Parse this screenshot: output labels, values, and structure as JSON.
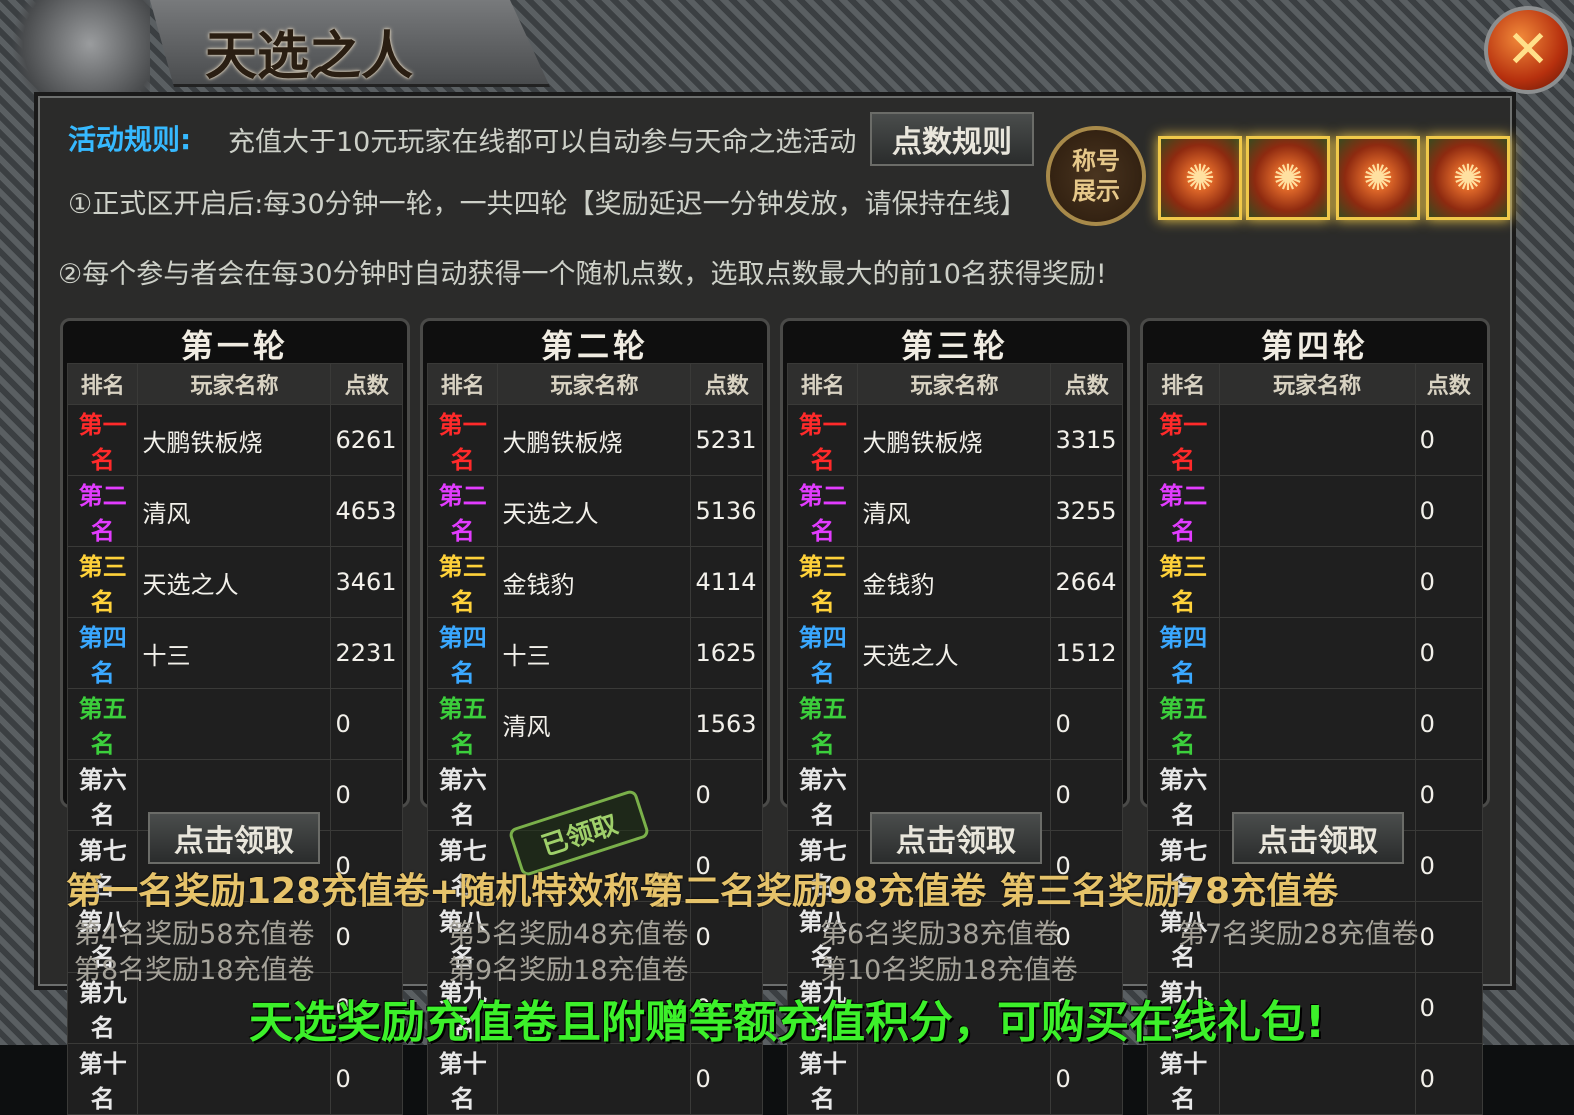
{
  "title": "天选之人",
  "close_icon": "✕",
  "rules": {
    "label": "活动规则:",
    "text": "充值大于10元玩家在线都可以自动参与天命之选活动",
    "points_rule_button": "点数规则",
    "line1": "①正式区开启后:每30分钟一轮，一共四轮【奖励延迟一分钟发放，请保持在线】",
    "line2": "②每个参与者会在每30分钟时自动获得一个随机点数，选取点数最大的前10名获得奖励!"
  },
  "title_display_badge": "称号展示",
  "rounds": [
    {
      "title": "第一轮",
      "headers": [
        "排名",
        "玩家名称",
        "点数"
      ],
      "rows": [
        {
          "rank": "第一名",
          "name": "大鹏铁板烧",
          "points": "6261"
        },
        {
          "rank": "第二名",
          "name": "清风",
          "points": "4653"
        },
        {
          "rank": "第三名",
          "name": "天选之人",
          "points": "3461"
        },
        {
          "rank": "第四名",
          "name": "十三",
          "points": "2231"
        },
        {
          "rank": "第五名",
          "name": "",
          "points": "0"
        },
        {
          "rank": "第六名",
          "name": "",
          "points": "0"
        },
        {
          "rank": "第七名",
          "name": "",
          "points": "0"
        },
        {
          "rank": "第八名",
          "name": "",
          "points": "0"
        },
        {
          "rank": "第九名",
          "name": "",
          "points": "0"
        },
        {
          "rank": "第十名",
          "name": "",
          "points": "0"
        }
      ],
      "claim": "点击领取"
    },
    {
      "title": "第二轮",
      "headers": [
        "排名",
        "玩家名称",
        "点数"
      ],
      "rows": [
        {
          "rank": "第一名",
          "name": "大鹏铁板烧",
          "points": "5231"
        },
        {
          "rank": "第二名",
          "name": "天选之人",
          "points": "5136"
        },
        {
          "rank": "第三名",
          "name": "金钱豹",
          "points": "4114"
        },
        {
          "rank": "第四名",
          "name": "十三",
          "points": "1625"
        },
        {
          "rank": "第五名",
          "name": "清风",
          "points": "1563"
        },
        {
          "rank": "第六名",
          "name": "",
          "points": "0"
        },
        {
          "rank": "第七名",
          "name": "",
          "points": "0"
        },
        {
          "rank": "第八名",
          "name": "",
          "points": "0"
        },
        {
          "rank": "第九名",
          "name": "",
          "points": "0"
        },
        {
          "rank": "第十名",
          "name": "",
          "points": "0"
        }
      ],
      "claim": "已领取"
    },
    {
      "title": "第三轮",
      "headers": [
        "排名",
        "玩家名称",
        "点数"
      ],
      "rows": [
        {
          "rank": "第一名",
          "name": "大鹏铁板烧",
          "points": "3315"
        },
        {
          "rank": "第二名",
          "name": "清风",
          "points": "3255"
        },
        {
          "rank": "第三名",
          "name": "金钱豹",
          "points": "2664"
        },
        {
          "rank": "第四名",
          "name": "天选之人",
          "points": "1512"
        },
        {
          "rank": "第五名",
          "name": "",
          "points": "0"
        },
        {
          "rank": "第六名",
          "name": "",
          "points": "0"
        },
        {
          "rank": "第七名",
          "name": "",
          "points": "0"
        },
        {
          "rank": "第八名",
          "name": "",
          "points": "0"
        },
        {
          "rank": "第九名",
          "name": "",
          "points": "0"
        },
        {
          "rank": "第十名",
          "name": "",
          "points": "0"
        }
      ],
      "claim": "点击领取"
    },
    {
      "title": "第四轮",
      "headers": [
        "排名",
        "玩家名称",
        "点数"
      ],
      "rows": [
        {
          "rank": "第一名",
          "name": "",
          "points": "0"
        },
        {
          "rank": "第二名",
          "name": "",
          "points": "0"
        },
        {
          "rank": "第三名",
          "name": "",
          "points": "0"
        },
        {
          "rank": "第四名",
          "name": "",
          "points": "0"
        },
        {
          "rank": "第五名",
          "name": "",
          "points": "0"
        },
        {
          "rank": "第六名",
          "name": "",
          "points": "0"
        },
        {
          "rank": "第七名",
          "name": "",
          "points": "0"
        },
        {
          "rank": "第八名",
          "name": "",
          "points": "0"
        },
        {
          "rank": "第九名",
          "name": "",
          "points": "0"
        },
        {
          "rank": "第十名",
          "name": "",
          "points": "0"
        }
      ],
      "claim": "点击领取"
    }
  ],
  "rank_colors": [
    "#ff2a2a",
    "#e23cff",
    "#ffd23a",
    "#3aa8ff",
    "#3ccf3c",
    "#e8e8e8",
    "#e8e8e8",
    "#e8e8e8",
    "#e8e8e8",
    "#e8e8e8"
  ],
  "rewards": {
    "first": "第一名奖励128充值卷+随机特效称号",
    "second": "第二名奖励98充值卷",
    "third": "第三名奖励78充值卷",
    "r4": "第4名奖励58充值卷",
    "r5": "第5名奖励48充值卷",
    "r6": "第6名奖励38充值卷",
    "r7": "第7名奖励28充值卷",
    "r8": "第8名奖励18充值卷",
    "r9": "第9名奖励18充值卷",
    "r10": "第10名奖励18充值卷"
  },
  "bottom_note": "天选奖励充值卷且附赠等额充值积分，可购买在线礼包!"
}
